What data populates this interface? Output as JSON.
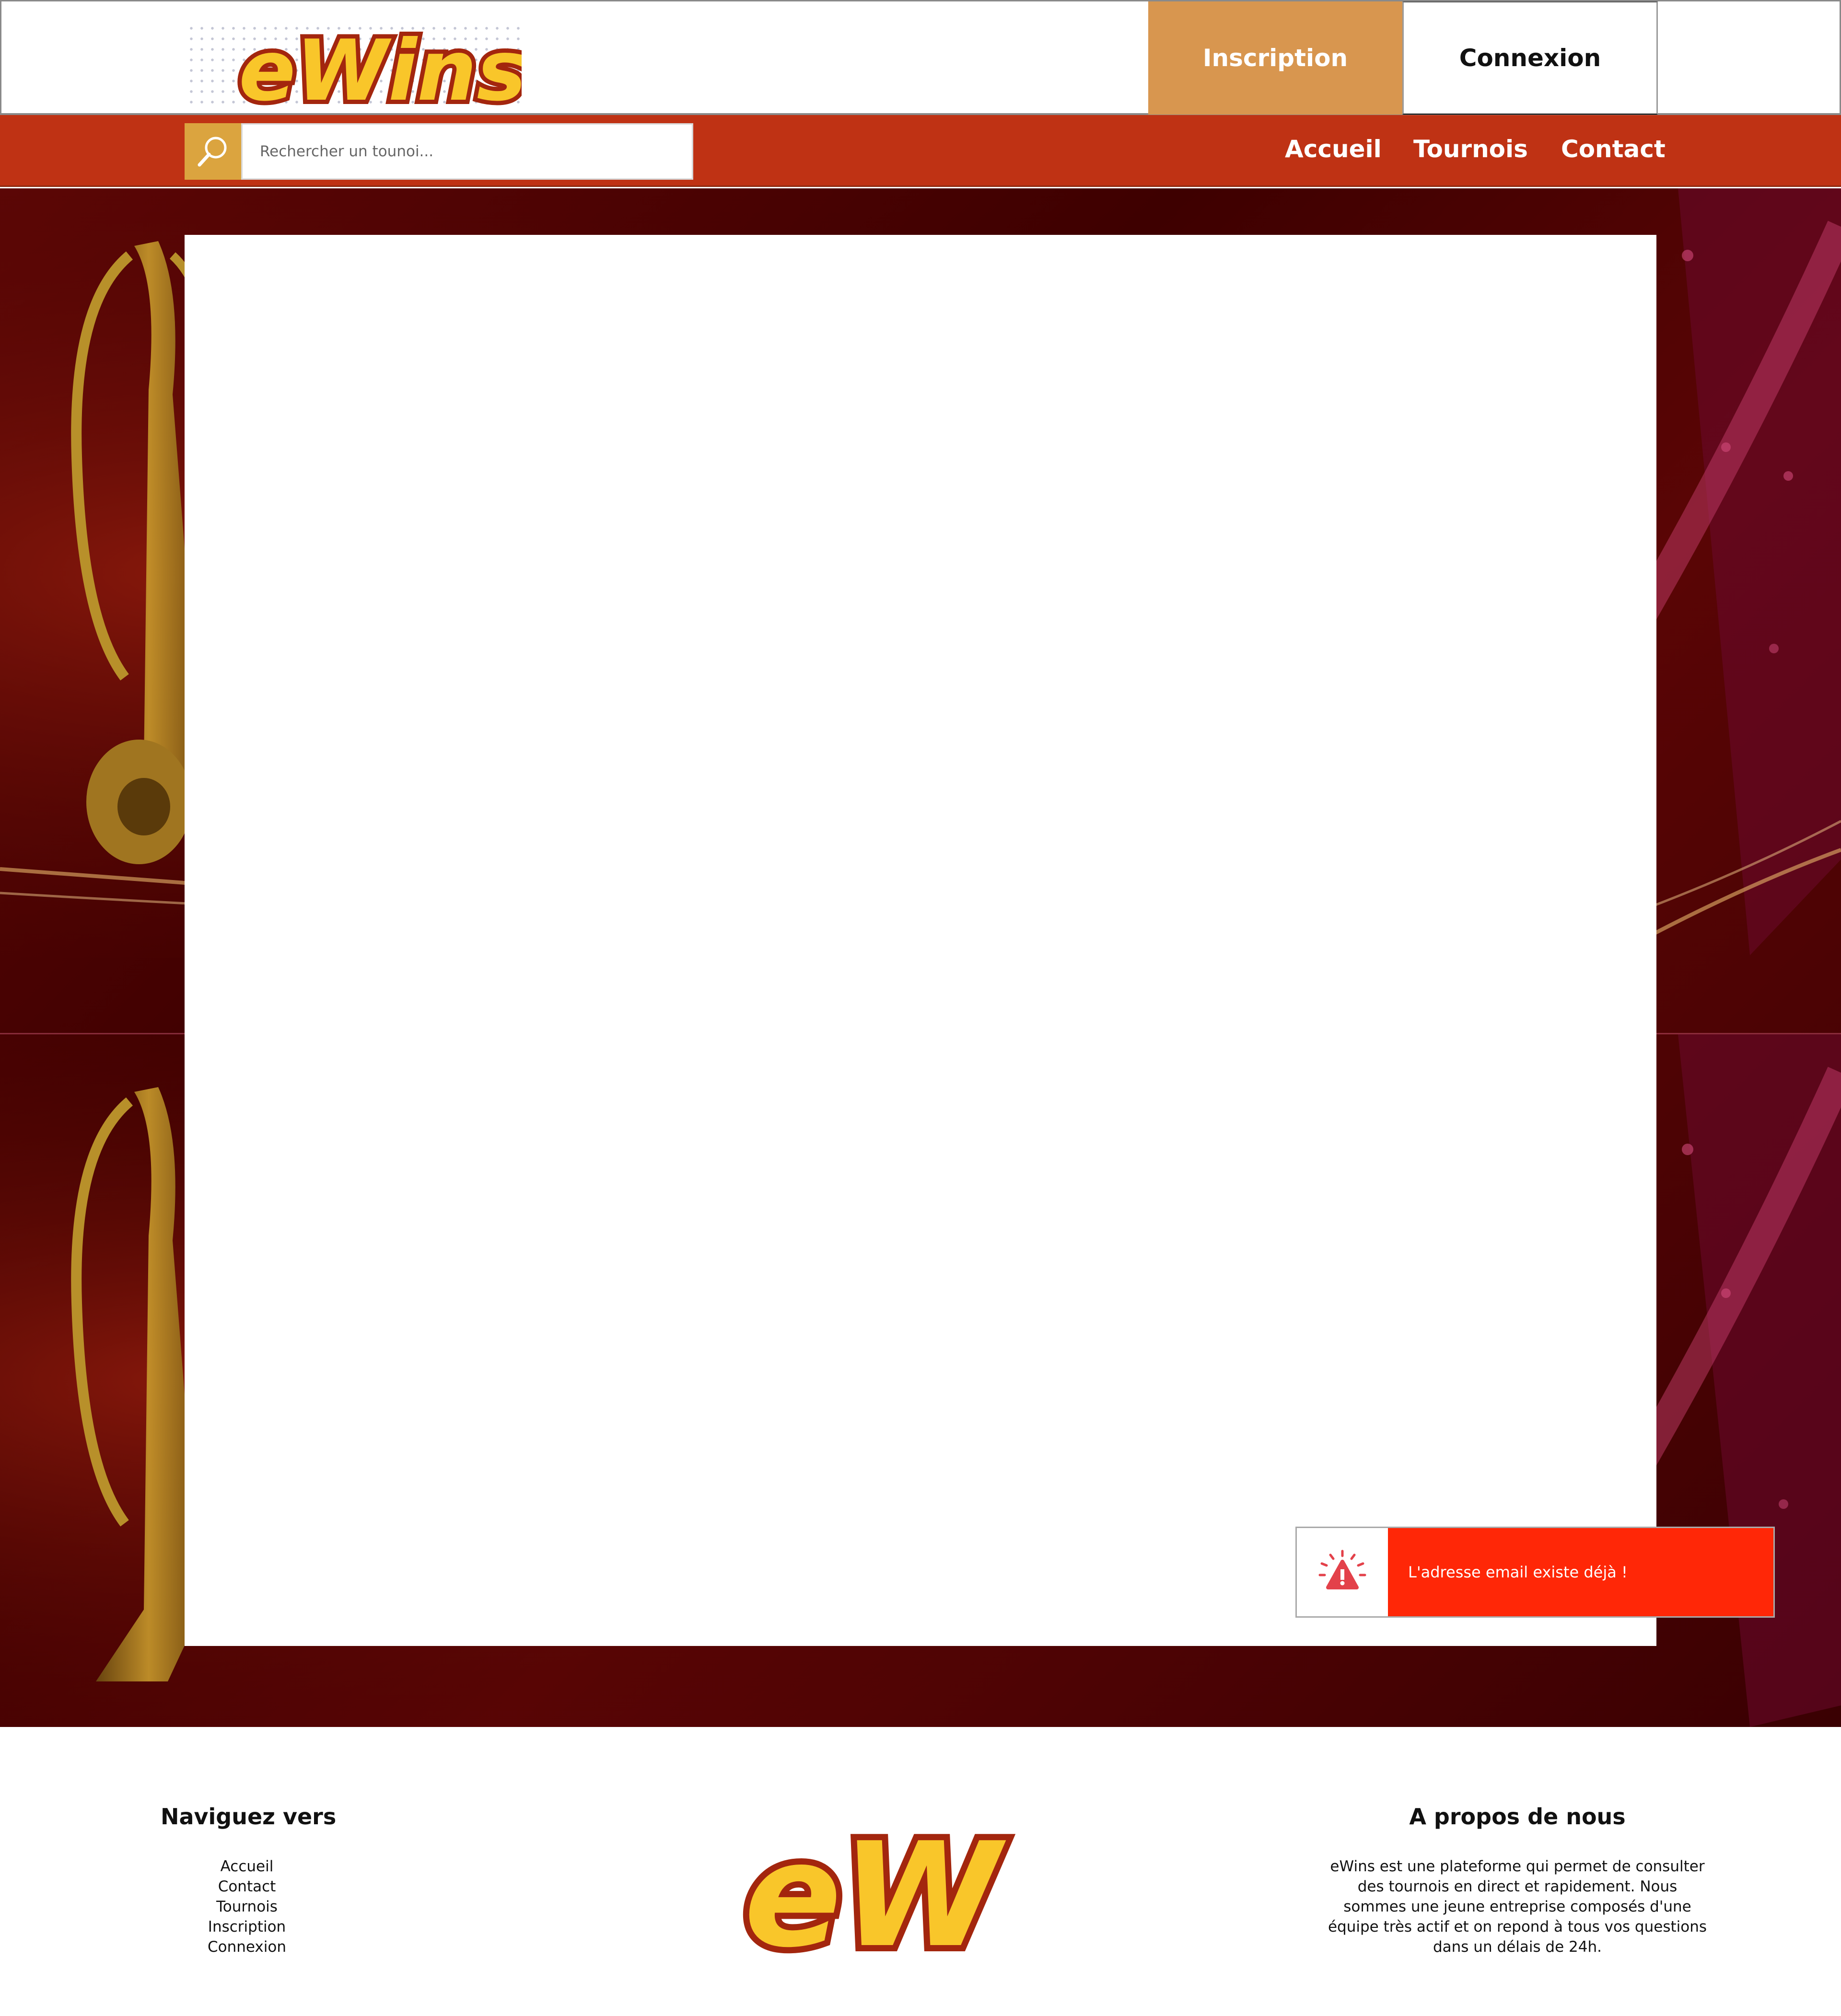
{
  "header": {
    "logo_text": "eWins",
    "inscription_label": "Inscription",
    "connexion_label": "Connexion"
  },
  "navbar": {
    "search_placeholder": "Rechercher un tounoi...",
    "links": [
      "Accueil",
      "Tournois",
      "Contact"
    ]
  },
  "toast": {
    "message": "L'adresse email existe déjà !",
    "icon": "warning-icon",
    "color": "#ff2707"
  },
  "footer": {
    "nav_title": "Naviguez vers",
    "nav_links": [
      "Accueil",
      "Contact",
      "Tournois",
      "Inscription",
      "Connexion"
    ],
    "logo_text": "eW",
    "about_title": "A propos de nous",
    "about_text": "eWins est une plateforme qui permet de consulter des tournois en direct et rapidement. Nous sommes une jeune entreprise composés d'une équipe très actif et on repond à tous vos questions dans un délais de 24h."
  },
  "colors": {
    "brand_red": "#bf3214",
    "inscription_orange": "#d8964f",
    "search_gold": "#dba43f",
    "logo_yellow": "#f9c62a",
    "logo_outline": "#a3260e"
  }
}
